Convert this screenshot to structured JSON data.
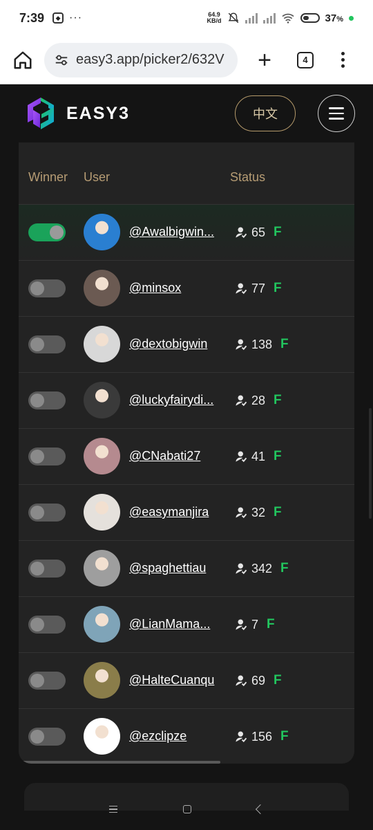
{
  "status_bar": {
    "time": "7:39",
    "speed_value": "64.9",
    "speed_unit": "KB/d",
    "battery": "37",
    "battery_suffix": "%"
  },
  "browser": {
    "url": "easy3.app/picker2/632V",
    "tab_count": "4"
  },
  "header": {
    "brand": "EASY3",
    "language_button": "中文"
  },
  "table": {
    "columns": {
      "winner": "Winner",
      "user": "User",
      "status": "Status"
    },
    "rows": [
      {
        "username": "@Awalbigwin...",
        "count": "65",
        "badge": "F",
        "winner": true,
        "avatar_color": "#2a7fd1"
      },
      {
        "username": "@minsox",
        "count": "77",
        "badge": "F",
        "winner": false,
        "avatar_color": "#6b5a52"
      },
      {
        "username": "@dextobigwin",
        "count": "138",
        "badge": "F",
        "winner": false,
        "avatar_color": "#d8d8d8"
      },
      {
        "username": "@luckyfairydi...",
        "count": "28",
        "badge": "F",
        "winner": false,
        "avatar_color": "#3a3a3a"
      },
      {
        "username": "@CNabati27",
        "count": "41",
        "badge": "F",
        "winner": false,
        "avatar_color": "#b58a8f"
      },
      {
        "username": "@easymanjira",
        "count": "32",
        "badge": "F",
        "winner": false,
        "avatar_color": "#e5e1dc"
      },
      {
        "username": "@spaghettiau",
        "count": "342",
        "badge": "F",
        "winner": false,
        "avatar_color": "#9e9e9e"
      },
      {
        "username": "@LianMama...",
        "count": "7",
        "badge": "F",
        "winner": false,
        "avatar_color": "#7fa4b8"
      },
      {
        "username": "@HalteCuanqu",
        "count": "69",
        "badge": "F",
        "winner": false,
        "avatar_color": "#8a7d4a"
      },
      {
        "username": "@ezclipze",
        "count": "156",
        "badge": "F",
        "winner": false,
        "avatar_color": "#ffffff"
      }
    ]
  },
  "colors": {
    "accent_gold": "#b69c74",
    "toggle_on": "#1aa35a",
    "badge_green": "#22c55e",
    "background": "#141414"
  }
}
